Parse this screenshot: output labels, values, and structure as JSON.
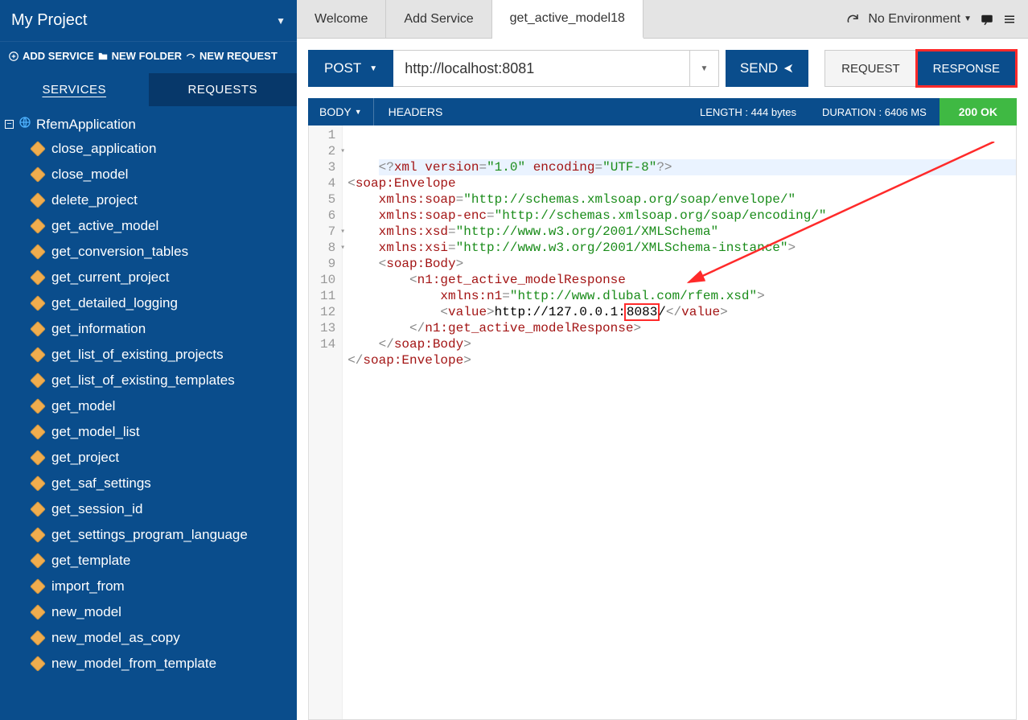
{
  "project": {
    "title": "My Project",
    "actions": {
      "add_service": "ADD SERVICE",
      "new_folder": "NEW FOLDER",
      "new_request": "NEW REQUEST"
    },
    "tabs": {
      "services": "SERVICES",
      "requests": "REQUESTS"
    },
    "root": "RfemApplication",
    "services": [
      "close_application",
      "close_model",
      "delete_project",
      "get_active_model",
      "get_conversion_tables",
      "get_current_project",
      "get_detailed_logging",
      "get_information",
      "get_list_of_existing_projects",
      "get_list_of_existing_templates",
      "get_model",
      "get_model_list",
      "get_project",
      "get_saf_settings",
      "get_session_id",
      "get_settings_program_language",
      "get_template",
      "import_from",
      "new_model",
      "new_model_as_copy",
      "new_model_from_template"
    ]
  },
  "topbar": {
    "tabs": [
      "Welcome",
      "Add Service",
      "get_active_model18"
    ],
    "active_tab": 2,
    "environment": "No Environment"
  },
  "request": {
    "method": "POST",
    "url": "http://localhost:8081",
    "send": "SEND",
    "request_btn": "REQUEST",
    "response_btn": "RESPONSE"
  },
  "response": {
    "tabs": {
      "body": "BODY",
      "headers": "HEADERS"
    },
    "length_label": "LENGTH : 444 bytes",
    "duration_label": "DURATION : 6406 MS",
    "status": "200 OK",
    "highlight_port": "8083",
    "lines": [
      {
        "n": 1,
        "indent": 0,
        "html": "<span class='t-punc'>&lt;?</span><span class='t-tag'>xml</span> <span class='t-attr'>version</span><span class='t-punc'>=</span><span class='t-str'>\"1.0\"</span> <span class='t-attr'>encoding</span><span class='t-punc'>=</span><span class='t-str'>\"UTF-8\"</span><span class='t-punc'>?&gt;</span>",
        "first": true
      },
      {
        "n": 2,
        "indent": 0,
        "fold": true,
        "html": "<span class='t-punc'>&lt;</span><span class='t-tag'>soap:Envelope</span>"
      },
      {
        "n": 3,
        "indent": 1,
        "html": "<span class='t-attr'>xmlns:soap</span><span class='t-punc'>=</span><span class='t-str'>\"http://schemas.xmlsoap.org/soap/envelope/\"</span>"
      },
      {
        "n": 4,
        "indent": 1,
        "html": "<span class='t-attr'>xmlns:soap-enc</span><span class='t-punc'>=</span><span class='t-str'>\"http://schemas.xmlsoap.org/soap/encoding/\"</span>"
      },
      {
        "n": 5,
        "indent": 1,
        "html": "<span class='t-attr'>xmlns:xsd</span><span class='t-punc'>=</span><span class='t-str'>\"http://www.w3.org/2001/XMLSchema\"</span>"
      },
      {
        "n": 6,
        "indent": 1,
        "html": "<span class='t-attr'>xmlns:xsi</span><span class='t-punc'>=</span><span class='t-str'>\"http://www.w3.org/2001/XMLSchema-instance\"</span><span class='t-punc'>&gt;</span>"
      },
      {
        "n": 7,
        "indent": 1,
        "fold": true,
        "html": "<span class='t-punc'>&lt;</span><span class='t-tag'>soap:Body</span><span class='t-punc'>&gt;</span>"
      },
      {
        "n": 8,
        "indent": 2,
        "fold": true,
        "html": "<span class='t-punc'>&lt;</span><span class='t-tag'>n1:get_active_modelResponse</span>"
      },
      {
        "n": 9,
        "indent": 3,
        "html": "<span class='t-attr'>xmlns:n1</span><span class='t-punc'>=</span><span class='t-str'>\"http://www.dlubal.com/rfem.xsd\"</span><span class='t-punc'>&gt;</span>"
      },
      {
        "n": 10,
        "indent": 3,
        "html": "<span class='t-punc'>&lt;</span><span class='t-tag'>value</span><span class='t-punc'>&gt;</span><span class='t-text'>http://127.0.0.1:<span class='hl-box'>8083</span>/</span><span class='t-punc'>&lt;/</span><span class='t-tag'>value</span><span class='t-punc'>&gt;</span>"
      },
      {
        "n": 11,
        "indent": 2,
        "html": "<span class='t-punc'>&lt;/</span><span class='t-tag'>n1:get_active_modelResponse</span><span class='t-punc'>&gt;</span>"
      },
      {
        "n": 12,
        "indent": 1,
        "html": "<span class='t-punc'>&lt;/</span><span class='t-tag'>soap:Body</span><span class='t-punc'>&gt;</span>"
      },
      {
        "n": 13,
        "indent": 0,
        "html": "<span class='t-punc'>&lt;/</span><span class='t-tag'>soap:Envelope</span><span class='t-punc'>&gt;</span>"
      },
      {
        "n": 14,
        "indent": 0,
        "html": ""
      }
    ]
  }
}
